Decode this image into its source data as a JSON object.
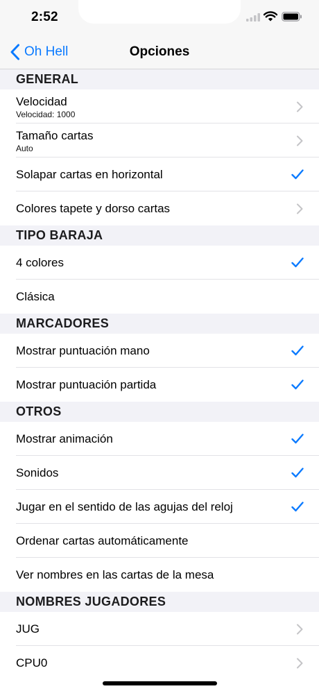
{
  "status": {
    "time": "2:52"
  },
  "nav": {
    "back_label": "Oh Hell",
    "title": "Opciones"
  },
  "colors": {
    "accent": "#0a7aff",
    "chevron": "#c4c4c7",
    "group_bg": "#f2f2f7"
  },
  "sections": [
    {
      "title": "GENERAL",
      "rows": [
        {
          "label": "Velocidad",
          "sub": "Velocidad: 1000",
          "accessory": "chevron-icon"
        },
        {
          "label": "Tamaño cartas",
          "sub": "Auto",
          "accessory": "chevron-icon"
        },
        {
          "label": "Solapar cartas en horizontal",
          "accessory": "checkmark-icon"
        },
        {
          "label": "Colores tapete y dorso cartas",
          "accessory": "chevron-icon"
        }
      ]
    },
    {
      "title": "TIPO BARAJA",
      "rows": [
        {
          "label": "4 colores",
          "accessory": "checkmark-icon"
        },
        {
          "label": "Clásica",
          "accessory": "none"
        }
      ]
    },
    {
      "title": "MARCADORES",
      "rows": [
        {
          "label": "Mostrar puntuación mano",
          "accessory": "checkmark-icon"
        },
        {
          "label": "Mostrar puntuación partida",
          "accessory": "checkmark-icon"
        }
      ]
    },
    {
      "title": "OTROS",
      "rows": [
        {
          "label": "Mostrar animación",
          "accessory": "checkmark-icon"
        },
        {
          "label": "Sonidos",
          "accessory": "checkmark-icon"
        },
        {
          "label": "Jugar en el sentido de las agujas del reloj",
          "accessory": "checkmark-icon"
        },
        {
          "label": "Ordenar cartas automáticamente",
          "accessory": "none"
        },
        {
          "label": "Ver nombres en las cartas de la mesa",
          "accessory": "none"
        }
      ]
    },
    {
      "title": "NOMBRES JUGADORES",
      "rows": [
        {
          "label": "JUG",
          "accessory": "chevron-icon"
        },
        {
          "label": "CPU0",
          "accessory": "chevron-icon"
        }
      ]
    }
  ]
}
